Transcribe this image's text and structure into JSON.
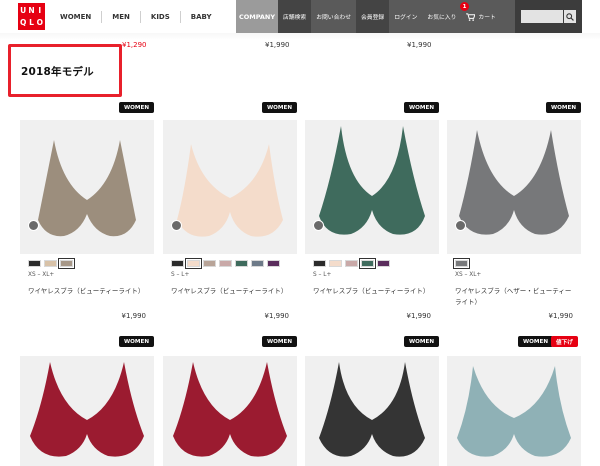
{
  "header": {
    "logo_letters": [
      "U",
      "N",
      "I",
      "Q",
      "L",
      "O"
    ],
    "nav": [
      "WOMEN",
      "MEN",
      "KIDS",
      "BABY"
    ],
    "company": "COMPANY",
    "utility": [
      "店舗検索",
      "お問い合わせ",
      "会員登録",
      "ログイン",
      "お気に入り"
    ],
    "favorites_count": "1",
    "cart": "カート",
    "search_placeholder": ""
  },
  "previous_row": {
    "prices": [
      "¥1,290",
      "¥1,990",
      "¥1,990"
    ]
  },
  "section_title": "2018年モデル",
  "products_row1": [
    {
      "tag": "WOMEN",
      "image_color": "#9c8e7d",
      "swatches": [
        "#2b2b2b",
        "#d8c2a8",
        "#a79888"
      ],
      "selected_swatch": 2,
      "sizes": "XS – XL+",
      "name": "ワイヤレスブラ（ビューティーライト）",
      "price": "¥1,990"
    },
    {
      "tag": "WOMEN",
      "image_color": "#f4dccb",
      "swatches": [
        "#2b2b2b",
        "#f4dccb",
        "#b8a498",
        "#c9a9a8",
        "#3f6b5d",
        "#6d7a88",
        "#5a2d5c"
      ],
      "selected_swatch": 1,
      "sizes": "S – L+",
      "name": "ワイヤレスブラ（ビューティーライト）",
      "price": "¥1,990"
    },
    {
      "tag": "WOMEN",
      "image_color": "#3f6b5d",
      "swatches": [
        "#2b2b2b",
        "#f4dccb",
        "#c9a9a8",
        "#3f6b5d",
        "#5a2d5c"
      ],
      "selected_swatch": 3,
      "sizes": "S – L+",
      "name": "ワイヤレスブラ（ビューティーライト）",
      "price": "¥1,990"
    },
    {
      "tag": "WOMEN",
      "image_color": "#77787a",
      "swatches": [
        "#77787a"
      ],
      "selected_swatch": 0,
      "sizes": "XS – XL+",
      "name": "ワイヤレスブラ（ヘザー・ビューティーライト）",
      "price": "¥1,990"
    }
  ],
  "products_row2": [
    {
      "tag": "WOMEN",
      "image_color": "#9b1b30"
    },
    {
      "tag": "WOMEN",
      "image_color": "#9b1b30"
    },
    {
      "tag": "WOMEN",
      "image_color": "#343434"
    },
    {
      "tag": "WOMEN",
      "tag2": "値下げ",
      "image_color": "#8fb1b6"
    }
  ]
}
